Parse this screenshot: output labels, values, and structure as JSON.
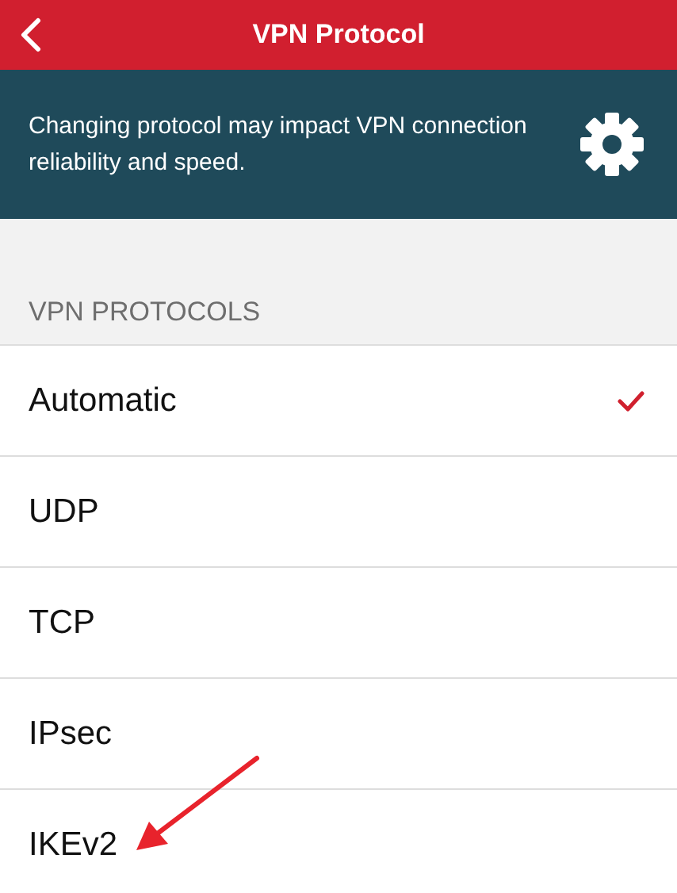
{
  "header": {
    "title": "VPN Protocol"
  },
  "banner": {
    "text": "Changing protocol may impact VPN connection reliability and speed."
  },
  "section": {
    "title": "VPN PROTOCOLS"
  },
  "protocols": [
    {
      "label": "Automatic",
      "selected": true
    },
    {
      "label": "UDP",
      "selected": false
    },
    {
      "label": "TCP",
      "selected": false
    },
    {
      "label": "IPsec",
      "selected": false
    },
    {
      "label": "IKEv2",
      "selected": false
    }
  ]
}
